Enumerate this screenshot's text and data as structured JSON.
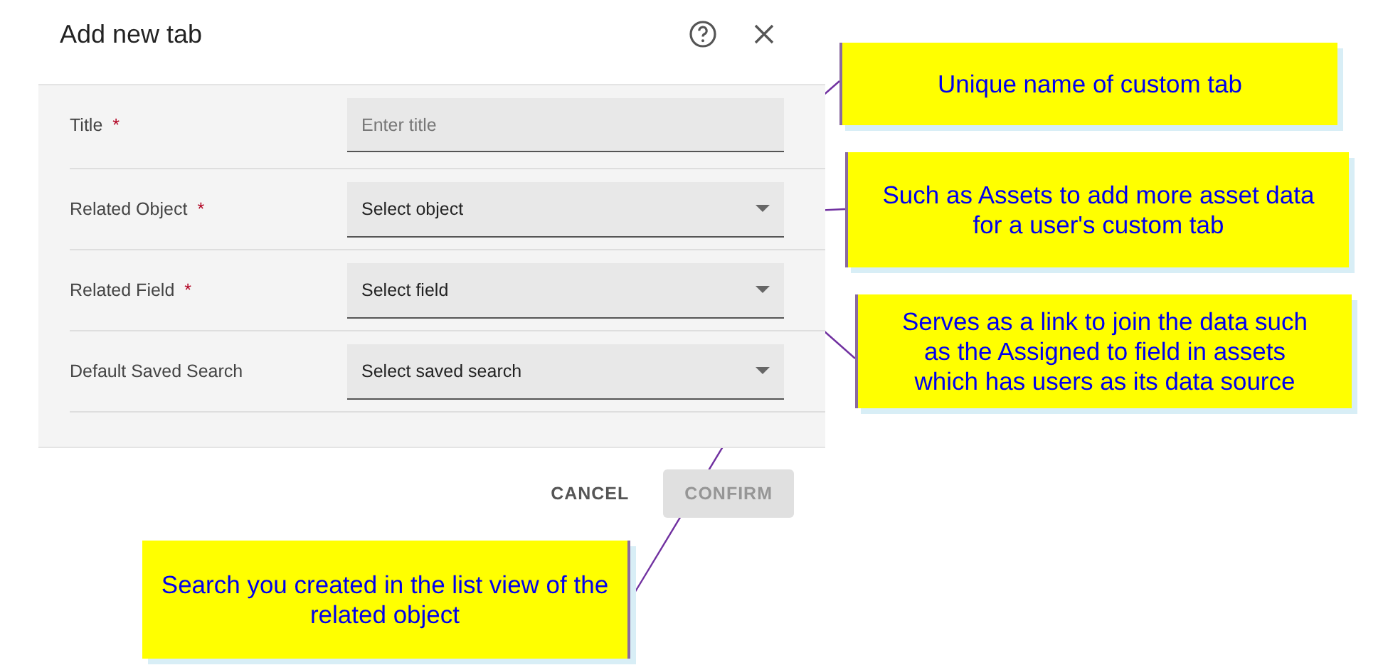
{
  "dialog": {
    "title": "Add new tab",
    "fields": [
      {
        "label": "Title",
        "required_mark": "*",
        "kind": "text",
        "placeholder": "Enter title"
      },
      {
        "label": "Related Object",
        "required_mark": "*",
        "kind": "select",
        "value": "Select object"
      },
      {
        "label": "Related Field",
        "required_mark": "*",
        "kind": "select",
        "value": "Select field"
      },
      {
        "label": "Default Saved Search",
        "kind": "select",
        "value": "Select saved search"
      }
    ],
    "buttons": [
      {
        "label": "CANCEL",
        "disabled": false
      },
      {
        "label": "CONFIRM",
        "disabled": true
      }
    ]
  },
  "callouts": [
    {
      "text": "Unique name of custom tab"
    },
    {
      "text": "Such as Assets to add more asset data for a user's custom tab"
    },
    {
      "text": "Serves as a link to join the data such as the Assigned to field in assets which has users as its data source"
    },
    {
      "text": "Search you created in the list view of the related object"
    }
  ]
}
